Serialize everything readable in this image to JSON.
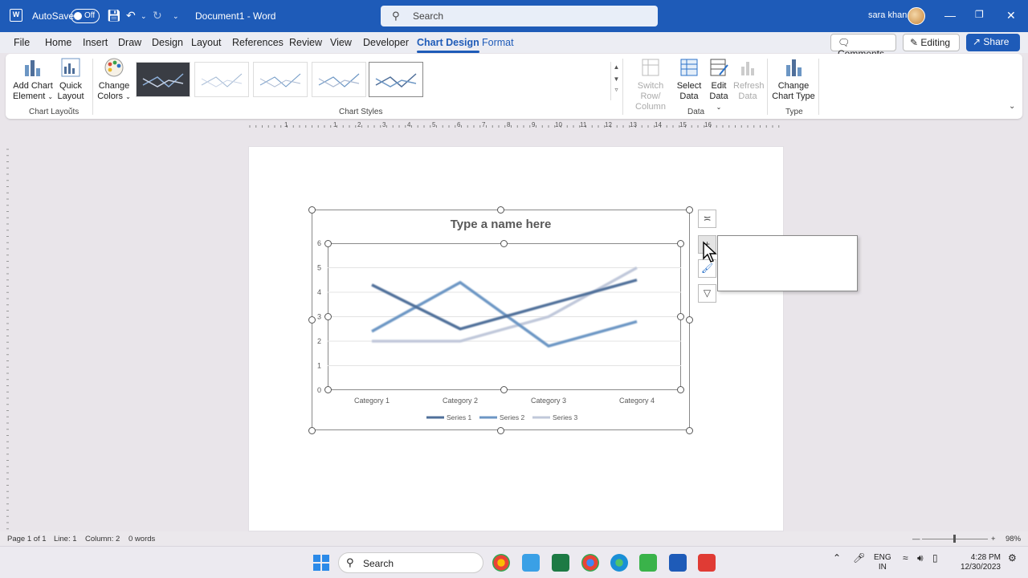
{
  "titlebar": {
    "autosave_label": "AutoSave",
    "autosave_state": "Off",
    "document_title": "Document1  -  Word",
    "search_placeholder": "Search",
    "user_name": "sara khan"
  },
  "menu": {
    "tabs": [
      "File",
      "Home",
      "Insert",
      "Draw",
      "Design",
      "Layout",
      "References",
      "Review",
      "View",
      "Developer",
      "Chart Design",
      "Format"
    ],
    "active_tab": "Chart Design",
    "comments_label": "Comments",
    "editing_label": "Editing",
    "share_label": "Share"
  },
  "ribbon": {
    "add_chart_element": [
      "Add Chart",
      "Element"
    ],
    "quick_layout": [
      "Quick",
      "Layout"
    ],
    "change_colors": [
      "Change",
      "Colors"
    ],
    "group_chart_layouts": "Chart Layouts",
    "group_chart_styles": "Chart Styles",
    "switch_row_column": [
      "Switch Row/",
      "Column"
    ],
    "select_data": [
      "Select",
      "Data"
    ],
    "edit_data": [
      "Edit",
      "Data"
    ],
    "refresh_data": [
      "Refresh",
      "Data"
    ],
    "group_data": "Data",
    "change_chart_type": [
      "Change",
      "Chart Type"
    ],
    "group_type": "Type"
  },
  "ruler": {
    "numbers": [
      "1",
      "2",
      "1",
      "1",
      "2",
      "3",
      "4",
      "5",
      "6",
      "7",
      "8",
      "9",
      "10",
      "11",
      "12",
      "13",
      "14",
      "15",
      "16"
    ]
  },
  "chart_data": {
    "type": "line",
    "title": "Type a name here",
    "categories": [
      "Category 1",
      "Category 2",
      "Category 3",
      "Category 4"
    ],
    "series": [
      {
        "name": "Series 1",
        "values": [
          4.3,
          2.5,
          3.5,
          4.5
        ],
        "color": "#4f6f9a"
      },
      {
        "name": "Series 2",
        "values": [
          2.4,
          4.4,
          1.8,
          2.8
        ],
        "color": "#6c96c4"
      },
      {
        "name": "Series 3",
        "values": [
          2.0,
          2.0,
          3.0,
          5.0
        ],
        "color": "#c0c8da"
      }
    ],
    "ylim": [
      0,
      6
    ],
    "yticks": [
      "0",
      "1",
      "2",
      "3",
      "4",
      "5",
      "6"
    ],
    "grid": true,
    "legend": "bottom"
  },
  "statusbar": {
    "page": "Page 1 of 1",
    "line": "Line: 1",
    "column": "Column: 2",
    "words": "0 words",
    "zoom": "98%"
  },
  "taskbar": {
    "search_placeholder": "Search",
    "lang_top": "ENG",
    "lang_bottom": "IN",
    "time": "4:28 PM",
    "date": "12/30/2023"
  },
  "colors": {
    "accent": "#1e5bb8"
  }
}
